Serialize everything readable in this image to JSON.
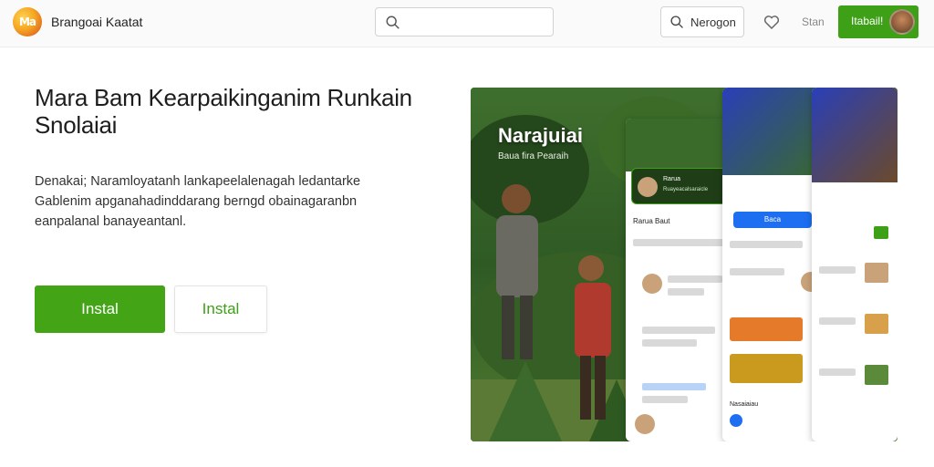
{
  "header": {
    "logo_text": "Ma",
    "brand_name": "Brangoai Kaatat",
    "search": {
      "placeholder": "",
      "value": ""
    },
    "nav_button_label": "Nerogon",
    "start_label": "Stan",
    "cta_label": "Itabail!"
  },
  "hero": {
    "headline": "Mara Bam Kearpaikinganim Runkain Snolaiai",
    "description": "Denakai; Naramloyatanh lankapeelalenagah ledantarke Gablenim apganahadinddarang berngd obainagaranbn eanpalanal banayeantanl.",
    "primary_button": "Instal",
    "secondary_button": "Instal"
  },
  "showcase": {
    "title": "Narajuiai",
    "subtitle": "Baua fira Pearaih",
    "phone_header_text": "Rarua Baut",
    "phone_card_title": "Rarua",
    "phone_card_sub": "Ruayeacalsaraicle",
    "phone_button_label": "Baca",
    "phone_banner": "Nasaiaiau"
  },
  "colors": {
    "accent_green": "#3da016",
    "link_blue": "#1d6ef0"
  }
}
